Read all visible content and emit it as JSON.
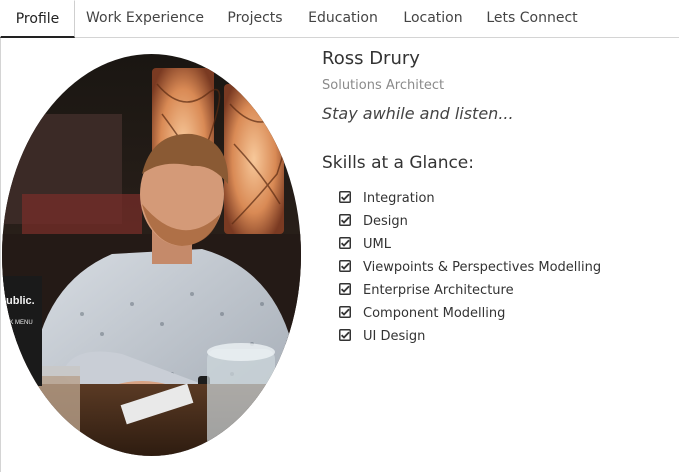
{
  "tabs": [
    {
      "label": "Profile",
      "active": true
    },
    {
      "label": "Work Experience",
      "active": false
    },
    {
      "label": "Projects",
      "active": false
    },
    {
      "label": "Education",
      "active": false
    },
    {
      "label": "Location",
      "active": false
    },
    {
      "label": "Lets Connect",
      "active": false
    }
  ],
  "profile": {
    "name": "Ross Drury",
    "role": "Solutions Architect",
    "tagline": "Stay awhile and listen...",
    "photo_menu_text": "ublic.",
    "photo_menu_subtext": "CK MENU"
  },
  "skills": {
    "title": "Skills at a Glance:",
    "icon": "checkbox-checked-icon",
    "items": [
      "Integration",
      "Design",
      "UML",
      "Viewpoints & Perspectives Modelling",
      "Enterprise Architecture",
      "Component Modelling",
      "UI Design"
    ]
  },
  "colors": {
    "text": "#333333",
    "muted": "#8a8a8a",
    "border": "#d4d4d4",
    "active_underline": "#222222"
  }
}
